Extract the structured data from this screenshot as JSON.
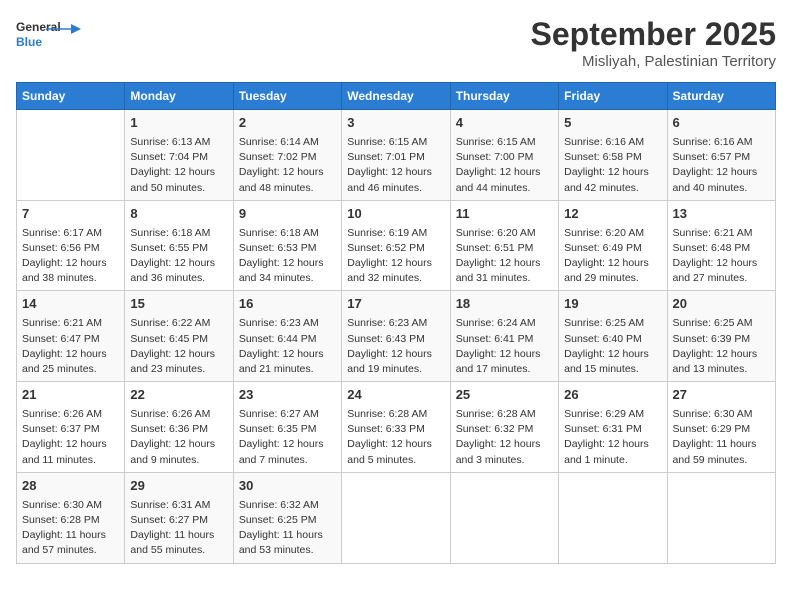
{
  "header": {
    "logo_general": "General",
    "logo_blue": "Blue",
    "month": "September 2025",
    "location": "Misliyah, Palestinian Territory"
  },
  "days_of_week": [
    "Sunday",
    "Monday",
    "Tuesday",
    "Wednesday",
    "Thursday",
    "Friday",
    "Saturday"
  ],
  "weeks": [
    [
      {
        "day": "",
        "content": ""
      },
      {
        "day": "1",
        "content": "Sunrise: 6:13 AM\nSunset: 7:04 PM\nDaylight: 12 hours\nand 50 minutes."
      },
      {
        "day": "2",
        "content": "Sunrise: 6:14 AM\nSunset: 7:02 PM\nDaylight: 12 hours\nand 48 minutes."
      },
      {
        "day": "3",
        "content": "Sunrise: 6:15 AM\nSunset: 7:01 PM\nDaylight: 12 hours\nand 46 minutes."
      },
      {
        "day": "4",
        "content": "Sunrise: 6:15 AM\nSunset: 7:00 PM\nDaylight: 12 hours\nand 44 minutes."
      },
      {
        "day": "5",
        "content": "Sunrise: 6:16 AM\nSunset: 6:58 PM\nDaylight: 12 hours\nand 42 minutes."
      },
      {
        "day": "6",
        "content": "Sunrise: 6:16 AM\nSunset: 6:57 PM\nDaylight: 12 hours\nand 40 minutes."
      }
    ],
    [
      {
        "day": "7",
        "content": "Sunrise: 6:17 AM\nSunset: 6:56 PM\nDaylight: 12 hours\nand 38 minutes."
      },
      {
        "day": "8",
        "content": "Sunrise: 6:18 AM\nSunset: 6:55 PM\nDaylight: 12 hours\nand 36 minutes."
      },
      {
        "day": "9",
        "content": "Sunrise: 6:18 AM\nSunset: 6:53 PM\nDaylight: 12 hours\nand 34 minutes."
      },
      {
        "day": "10",
        "content": "Sunrise: 6:19 AM\nSunset: 6:52 PM\nDaylight: 12 hours\nand 32 minutes."
      },
      {
        "day": "11",
        "content": "Sunrise: 6:20 AM\nSunset: 6:51 PM\nDaylight: 12 hours\nand 31 minutes."
      },
      {
        "day": "12",
        "content": "Sunrise: 6:20 AM\nSunset: 6:49 PM\nDaylight: 12 hours\nand 29 minutes."
      },
      {
        "day": "13",
        "content": "Sunrise: 6:21 AM\nSunset: 6:48 PM\nDaylight: 12 hours\nand 27 minutes."
      }
    ],
    [
      {
        "day": "14",
        "content": "Sunrise: 6:21 AM\nSunset: 6:47 PM\nDaylight: 12 hours\nand 25 minutes."
      },
      {
        "day": "15",
        "content": "Sunrise: 6:22 AM\nSunset: 6:45 PM\nDaylight: 12 hours\nand 23 minutes."
      },
      {
        "day": "16",
        "content": "Sunrise: 6:23 AM\nSunset: 6:44 PM\nDaylight: 12 hours\nand 21 minutes."
      },
      {
        "day": "17",
        "content": "Sunrise: 6:23 AM\nSunset: 6:43 PM\nDaylight: 12 hours\nand 19 minutes."
      },
      {
        "day": "18",
        "content": "Sunrise: 6:24 AM\nSunset: 6:41 PM\nDaylight: 12 hours\nand 17 minutes."
      },
      {
        "day": "19",
        "content": "Sunrise: 6:25 AM\nSunset: 6:40 PM\nDaylight: 12 hours\nand 15 minutes."
      },
      {
        "day": "20",
        "content": "Sunrise: 6:25 AM\nSunset: 6:39 PM\nDaylight: 12 hours\nand 13 minutes."
      }
    ],
    [
      {
        "day": "21",
        "content": "Sunrise: 6:26 AM\nSunset: 6:37 PM\nDaylight: 12 hours\nand 11 minutes."
      },
      {
        "day": "22",
        "content": "Sunrise: 6:26 AM\nSunset: 6:36 PM\nDaylight: 12 hours\nand 9 minutes."
      },
      {
        "day": "23",
        "content": "Sunrise: 6:27 AM\nSunset: 6:35 PM\nDaylight: 12 hours\nand 7 minutes."
      },
      {
        "day": "24",
        "content": "Sunrise: 6:28 AM\nSunset: 6:33 PM\nDaylight: 12 hours\nand 5 minutes."
      },
      {
        "day": "25",
        "content": "Sunrise: 6:28 AM\nSunset: 6:32 PM\nDaylight: 12 hours\nand 3 minutes."
      },
      {
        "day": "26",
        "content": "Sunrise: 6:29 AM\nSunset: 6:31 PM\nDaylight: 12 hours\nand 1 minute."
      },
      {
        "day": "27",
        "content": "Sunrise: 6:30 AM\nSunset: 6:29 PM\nDaylight: 11 hours\nand 59 minutes."
      }
    ],
    [
      {
        "day": "28",
        "content": "Sunrise: 6:30 AM\nSunset: 6:28 PM\nDaylight: 11 hours\nand 57 minutes."
      },
      {
        "day": "29",
        "content": "Sunrise: 6:31 AM\nSunset: 6:27 PM\nDaylight: 11 hours\nand 55 minutes."
      },
      {
        "day": "30",
        "content": "Sunrise: 6:32 AM\nSunset: 6:25 PM\nDaylight: 11 hours\nand 53 minutes."
      },
      {
        "day": "",
        "content": ""
      },
      {
        "day": "",
        "content": ""
      },
      {
        "day": "",
        "content": ""
      },
      {
        "day": "",
        "content": ""
      }
    ]
  ]
}
